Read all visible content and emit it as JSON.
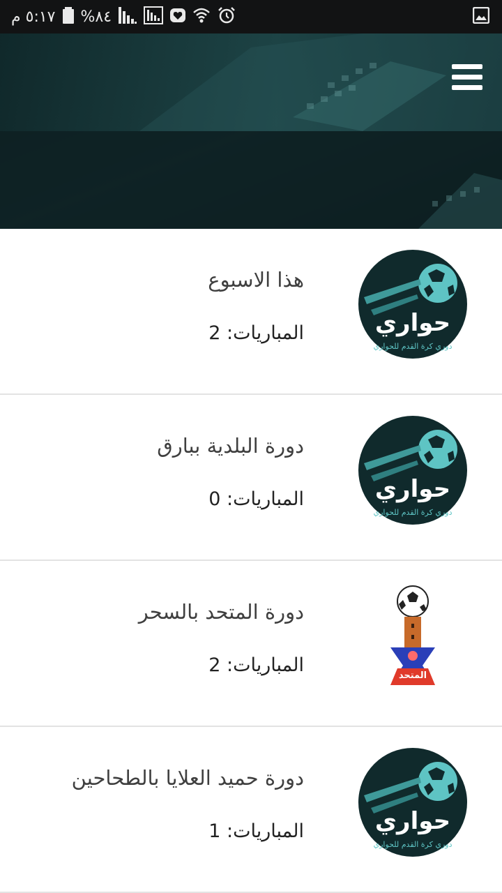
{
  "status_bar": {
    "time": "٥:١٧ م",
    "battery": "%٨٤",
    "icons": [
      "image-icon",
      "alarm-icon",
      "wifi-icon",
      "shield-icon",
      "signal-box-icon",
      "signal-icon",
      "battery-icon"
    ]
  },
  "header": {
    "menu_icon": "hamburger-menu-icon"
  },
  "colors": {
    "header_bg": "#11282a",
    "logo_teal": "#1f5f5f",
    "divider": "#e3e3e3"
  },
  "leagues": [
    {
      "title": "هذا الاسبوع",
      "matches": "المباريات: 2",
      "logo": "hawari-logo"
    },
    {
      "title": "دورة البلدية ببارق",
      "matches": "المباريات: 0",
      "logo": "hawari-logo"
    },
    {
      "title": "دورة المتحد بالسحر",
      "matches": "المباريات: 2",
      "logo": "almutahid-logo"
    },
    {
      "title": "دورة حميد العلايا بالطحاحين",
      "matches": "المباريات: 1",
      "logo": "hawari-logo"
    }
  ]
}
